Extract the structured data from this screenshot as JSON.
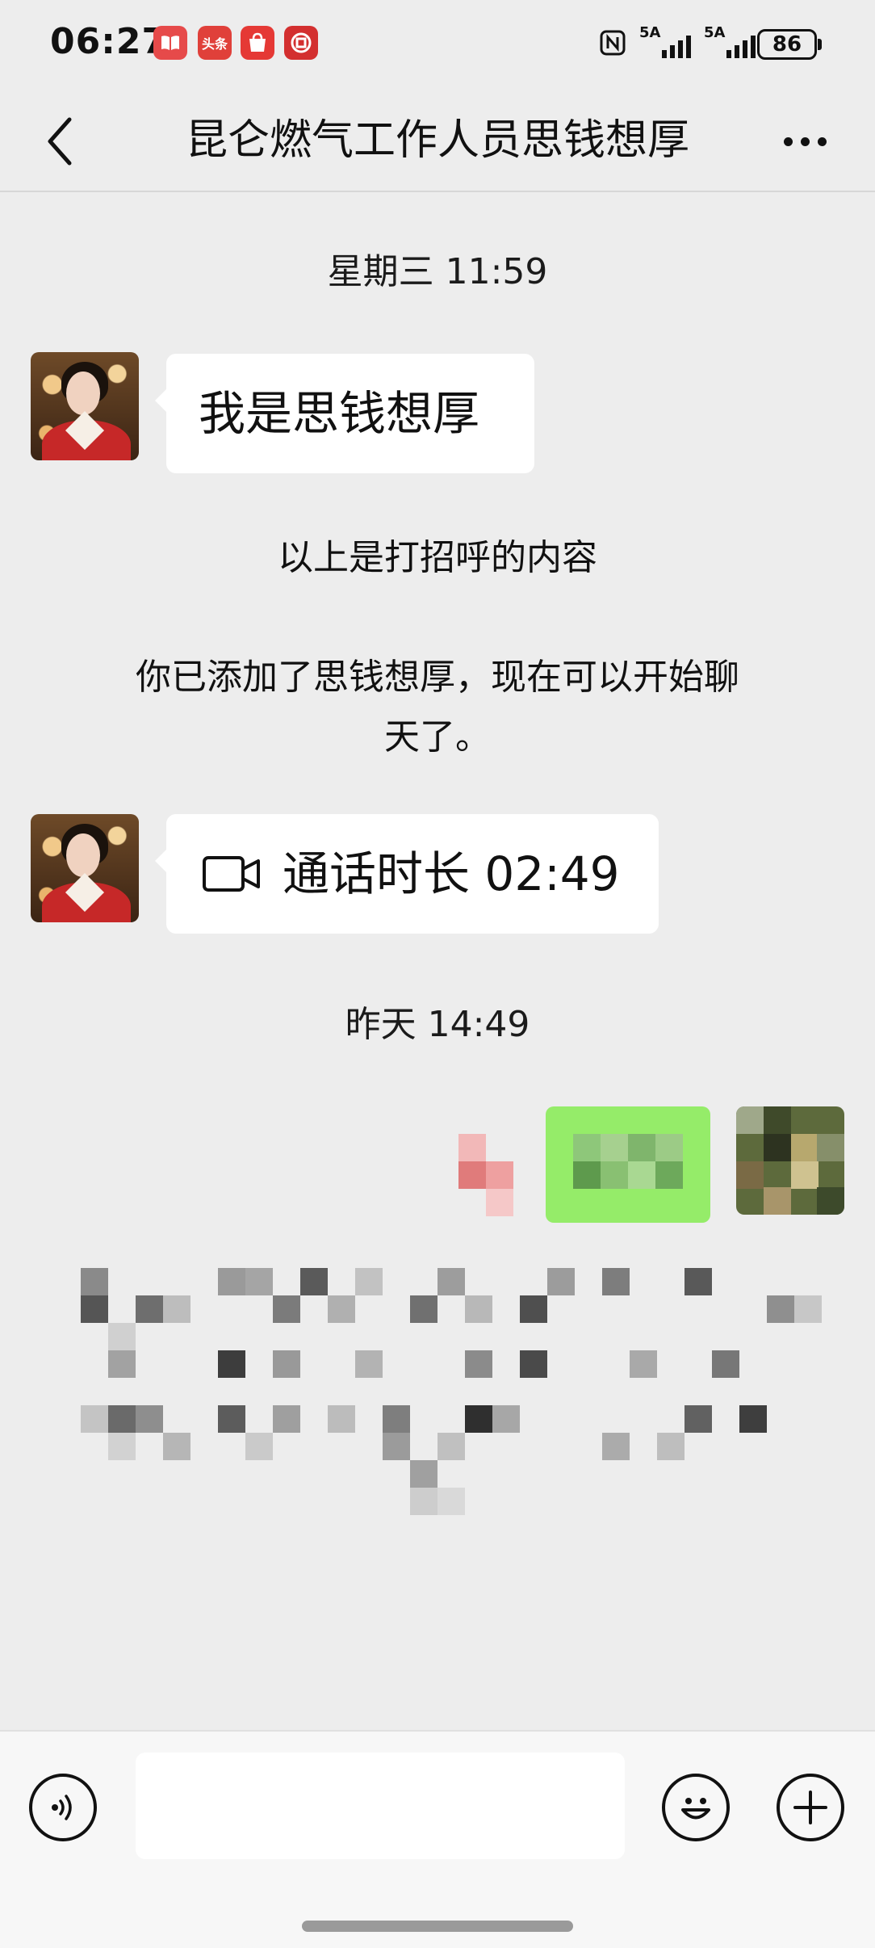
{
  "status_bar": {
    "time": "06:27",
    "notifications": [
      {
        "icon": "book-app-icon",
        "label": ""
      },
      {
        "icon": "toutiao-app-icon",
        "label": "头条"
      },
      {
        "icon": "app-gallery-icon",
        "label": "App Gallery"
      },
      {
        "icon": "bank-app-icon",
        "label": ""
      }
    ],
    "nfc_icon": "nfc-icon",
    "signal_1": "5A",
    "signal_2": "5A",
    "battery": "86"
  },
  "header": {
    "title": "昆仑燃气工作人员思钱想厚",
    "back_icon": "chevron-left-icon",
    "more_icon": "more-dots-icon"
  },
  "chat": {
    "timestamp_1": "星期三 11:59",
    "message_1": "我是思钱想厚",
    "system_1": "以上是打招呼的内容",
    "system_2_line1": "你已添加了思钱想厚，现在可以开始聊",
    "system_2_line2": "天了。",
    "call_label": "通话时长 02:49",
    "call_icon": "video-camera-icon",
    "timestamp_2": "昨天 14:49"
  },
  "input_bar": {
    "voice_icon": "voice-icon",
    "emoji_icon": "emoji-icon",
    "plus_icon": "plus-icon",
    "input_value": ""
  },
  "colors": {
    "background": "#ededed",
    "bubble_in": "#ffffff",
    "bubble_out": "#95ec69"
  }
}
